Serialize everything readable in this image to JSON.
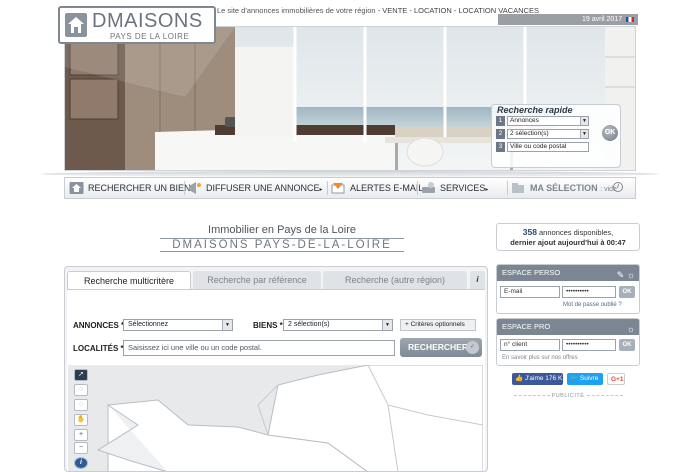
{
  "header": {
    "tagline": "Le site d'annonces immobilières de votre région",
    "links": "- VENTE - LOCATION - LOCATION VACANCES",
    "date": "19 avril 2017"
  },
  "logo": {
    "title": "DMAISONS",
    "subtitle": "PAYS DE LA LOIRE"
  },
  "quick_search": {
    "title": "Recherche rapide",
    "rows": [
      {
        "num": "1",
        "value": "Annonces"
      },
      {
        "num": "2",
        "value": "2 sélection(s)"
      },
      {
        "num": "3",
        "value": "Ville ou code postal"
      }
    ],
    "ok_label": "OK"
  },
  "nav": {
    "items": [
      {
        "label": "RECHERCHER UN BIEN",
        "arrow": "▸",
        "icon": "house-search-icon"
      },
      {
        "label": "DIFFUSER UNE ANNONCE",
        "arrow": "▸",
        "icon": "megaphone-icon"
      },
      {
        "label": "ALERTES E-MAIL",
        "arrow": "▸",
        "icon": "email-alert-icon"
      },
      {
        "label": "SERVICES",
        "arrow": "▸",
        "icon": "tools-icon"
      },
      {
        "label": "MA SÉLECTION",
        "suffix": ": vide",
        "icon": "folder-icon"
      }
    ]
  },
  "main": {
    "title": "Immobilier en Pays de la Loire",
    "subtitle": "DMAISONS PAYS-DE-LA-LOIRE"
  },
  "stats": {
    "count": "358",
    "text": "annonces disponibles,",
    "updated": "dernier ajout aujourd'hui à 00:47"
  },
  "search_panel": {
    "tabs": [
      "Recherche multicritère",
      "Recherche par référence",
      "Recherche (autre région)"
    ],
    "info_label": "i",
    "annonces_label": "ANNONCES *",
    "annonces_value": "Sélectionnez",
    "biens_label": "BIENS *",
    "biens_value": "2 sélection(s)",
    "criteria_label": "+ Critères optionnels",
    "localites_label": "LOCALITÉS *",
    "localites_placeholder": "Saisissez ici une ville ou un code postal.",
    "search_label": "RECHERCHER"
  },
  "espace_perso": {
    "title": "ESPACE PERSO",
    "email_placeholder": "E-mail",
    "password_value": "••••••••••",
    "ok_label": "OK",
    "forgot": "Mot de passe oublié ?"
  },
  "espace_pro": {
    "title": "ESPACE PRO",
    "client_placeholder": "n° client",
    "password_value": "••••••••••",
    "ok_label": "OK",
    "more": "En savoir plus sur nos offres"
  },
  "social": {
    "like": "J'aime 176 K",
    "follow": "Suivre",
    "gplus": "G+1"
  },
  "pub_label": "PUBLICITÉ",
  "colors": {
    "accent": "#7b8692",
    "facebook": "#3b5998",
    "twitter": "#1da1f2",
    "gplus": "#dd4b39"
  }
}
